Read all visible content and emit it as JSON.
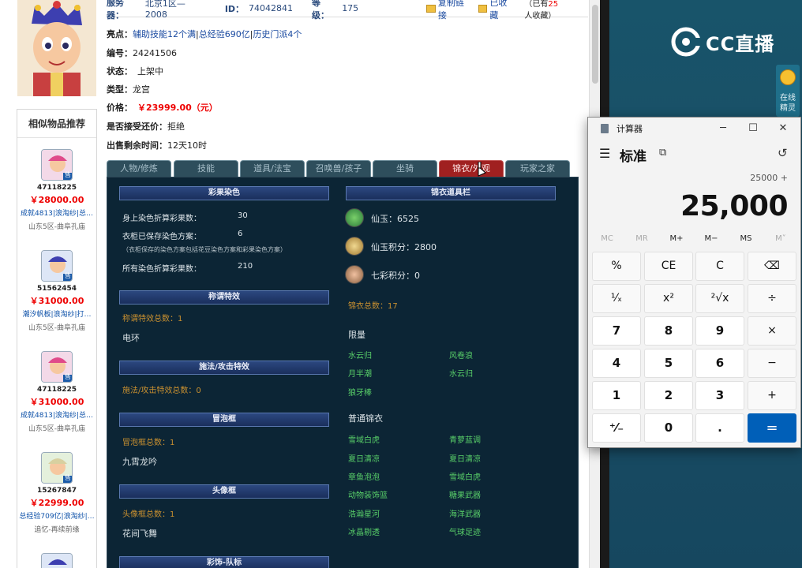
{
  "header": {
    "server_label": "服务器：",
    "server_value": "北京1区—2008",
    "id_label": "ID：",
    "id_value": "74042841",
    "level_label": "等级：",
    "level_value": "175",
    "copy_link": "复制链接",
    "favorited": "已收藏",
    "fav_note_a": "（已有",
    "fav_note_count": "25",
    "fav_note_b": "人收藏）"
  },
  "details": {
    "highlight_label": "亮点：",
    "highlight_a": "辅助技能12个满",
    "highlight_b": "总经验690亿",
    "highlight_c": "历史门派4个",
    "serial_label": "编号：",
    "serial_value": "24241506",
    "status_label": "状态：",
    "status_value": "上架中",
    "type_label": "类型：",
    "type_value": "龙宫",
    "price_label": "价格：",
    "price_value": "￥23999.00（元）",
    "accept_label": "是否接受还价：",
    "accept_value": "拒绝",
    "remain_label": "出售剩余时间：",
    "remain_value": "12天10时"
  },
  "similar": {
    "title": "相似物品推荐",
    "items": [
      {
        "id": "47118225",
        "price": "￥28000.00",
        "desc": "成就4813|浪淘纱|总…",
        "server": "山东5区-曲阜孔庙"
      },
      {
        "id": "51562454",
        "price": "￥31000.00",
        "desc": "潮汐帆板|浪淘纱|打…",
        "server": "山东5区-曲阜孔庙"
      },
      {
        "id": "47118225",
        "price": "￥31000.00",
        "desc": "成就4813|浪淘纱|总…",
        "server": "山东5区-曲阜孔庙"
      },
      {
        "id": "15267847",
        "price": "￥22999.00",
        "desc": "总经验709亿|浪淘纱|…",
        "server": "追忆-再续前缘"
      }
    ],
    "badge": "售"
  },
  "tabs": [
    "人物/修炼",
    "技能",
    "道具/法宝",
    "召唤兽/孩子",
    "坐骑",
    "锦衣/外观",
    "玩家之家"
  ],
  "panel": {
    "dye": {
      "title": "彩果染色",
      "l1": "身上染色折算彩果数：",
      "v1": "30",
      "l2": "衣柜已保存染色方案：",
      "v2": "6",
      "note": "（衣柜保存的染色方案包括花豆染色方案和彩果染色方案）",
      "l3": "所有染色折算彩果数：",
      "v3": "210"
    },
    "title_fx": {
      "title": "称谓特效",
      "count": "称谓特效总数：1",
      "item": "电环"
    },
    "spell_fx": {
      "title": "施法/攻击特效",
      "count": "施法/攻击特效总数：0"
    },
    "bubble": {
      "title": "冒泡框",
      "count": "冒泡框总数：1",
      "item": "九霄龙吟"
    },
    "avatar_frame": {
      "title": "头像框",
      "count": "头像框总数：1",
      "item": "花间飞舞"
    },
    "team": {
      "title": "彩饰-队标"
    },
    "wardrobe": {
      "title": "锦衣道具栏",
      "xianyu": "仙玉：6525",
      "xianyu_points": "仙玉积分：2800",
      "qicai_points": "七彩积分：0",
      "total": "锦衣总数：17",
      "limited_title": "限量",
      "limited": [
        "水云归",
        "风卷浪",
        "月半潮",
        "水云归",
        "狼牙棒"
      ],
      "normal_title": "普通锦衣",
      "normal": [
        "雪域白虎",
        "青萝蓝调",
        "夏日清凉",
        "夏日清凉",
        "章鱼泡泡",
        "雪域白虎",
        "动物装饰篮",
        "糖果武器",
        "浩瀚星河",
        "海洋武器",
        "冰晶剔透",
        "气球足迹"
      ]
    }
  },
  "stream": {
    "logo_text": "CC直播",
    "online_a": "在线",
    "online_b": "精灵"
  },
  "calculator": {
    "title": "计算器",
    "mode": "标准",
    "expression": "25000 +",
    "display": "25,000",
    "memory": [
      "MC",
      "MR",
      "M+",
      "M−",
      "MS",
      "M˅"
    ],
    "keys": [
      [
        "%",
        "CE",
        "C",
        "⌫"
      ],
      [
        "¹⁄ₓ",
        "x²",
        "²√x",
        "÷"
      ],
      [
        "7",
        "8",
        "9",
        "×"
      ],
      [
        "4",
        "5",
        "6",
        "−"
      ],
      [
        "1",
        "2",
        "3",
        "+"
      ],
      [
        "⁺⁄₋",
        "0",
        ".",
        "="
      ]
    ]
  },
  "colors": {
    "accent_tab": "#a02020",
    "panel_bg": "#0c2535",
    "calc_equals": "#005fb8",
    "price_red": "#e00000",
    "stream_bg": "#1a4e66"
  }
}
